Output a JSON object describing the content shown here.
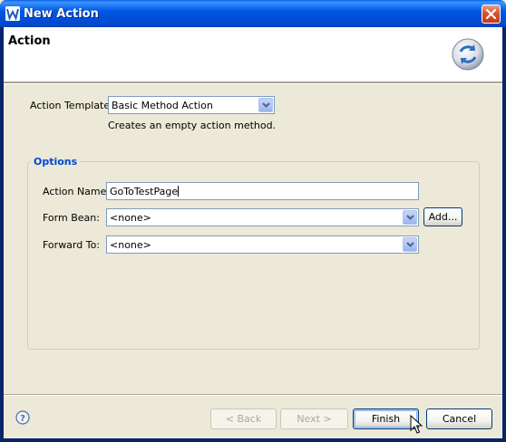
{
  "window": {
    "title": "New Action",
    "app_icon": "W"
  },
  "banner": {
    "title": "Action",
    "icon": "wizard-refresh-icon"
  },
  "template": {
    "label": "Action Template:",
    "value": "Basic Method Action",
    "description": "Creates an empty action method."
  },
  "options": {
    "title": "Options",
    "action_name": {
      "label": "Action Name:",
      "value": "GoToTestPage"
    },
    "form_bean": {
      "label": "Form Bean:",
      "value": "<none>",
      "add_label": "Add..."
    },
    "forward_to": {
      "label": "Forward To:",
      "value": "<none>"
    }
  },
  "buttons": {
    "back": "< Back",
    "next": "Next >",
    "finish": "Finish",
    "cancel": "Cancel"
  }
}
